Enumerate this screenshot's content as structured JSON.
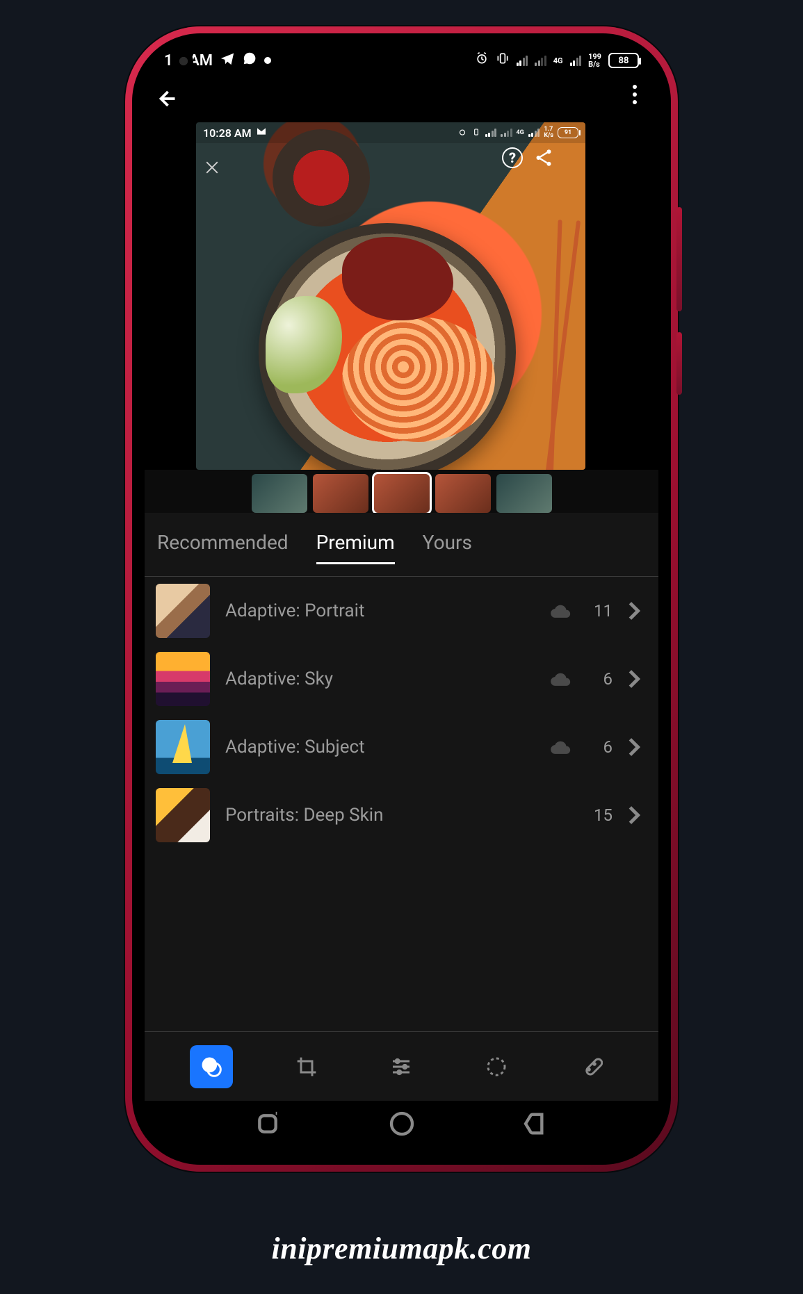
{
  "statusbar_outer": {
    "time": "1    6 AM",
    "net_label": "4G",
    "speed_top": "199",
    "speed_unit": "B/s",
    "battery": "88"
  },
  "statusbar_inner": {
    "time": "10:28 AM",
    "net_label": "4G",
    "speed_top": "1.7",
    "speed_unit": "K/s",
    "battery": "91"
  },
  "tabs": {
    "recommended": "Recommended",
    "premium": "Premium",
    "yours": "Yours",
    "active": "premium"
  },
  "presets": [
    {
      "name": "Adaptive: Portrait",
      "count": "11",
      "cloud": true,
      "thumb": "t-portrait"
    },
    {
      "name": "Adaptive: Sky",
      "count": "6",
      "cloud": true,
      "thumb": "t-sky"
    },
    {
      "name": "Adaptive: Subject",
      "count": "6",
      "cloud": true,
      "thumb": "t-subject"
    },
    {
      "name": "Portraits: Deep Skin",
      "count": "15",
      "cloud": false,
      "thumb": "t-deep"
    }
  ],
  "toolbar": {
    "presets": "Presets",
    "crop": "Crop",
    "adjust": "Adjust",
    "mask": "Masking",
    "heal": "Healing"
  },
  "watermark": "inipremiumapk.com"
}
